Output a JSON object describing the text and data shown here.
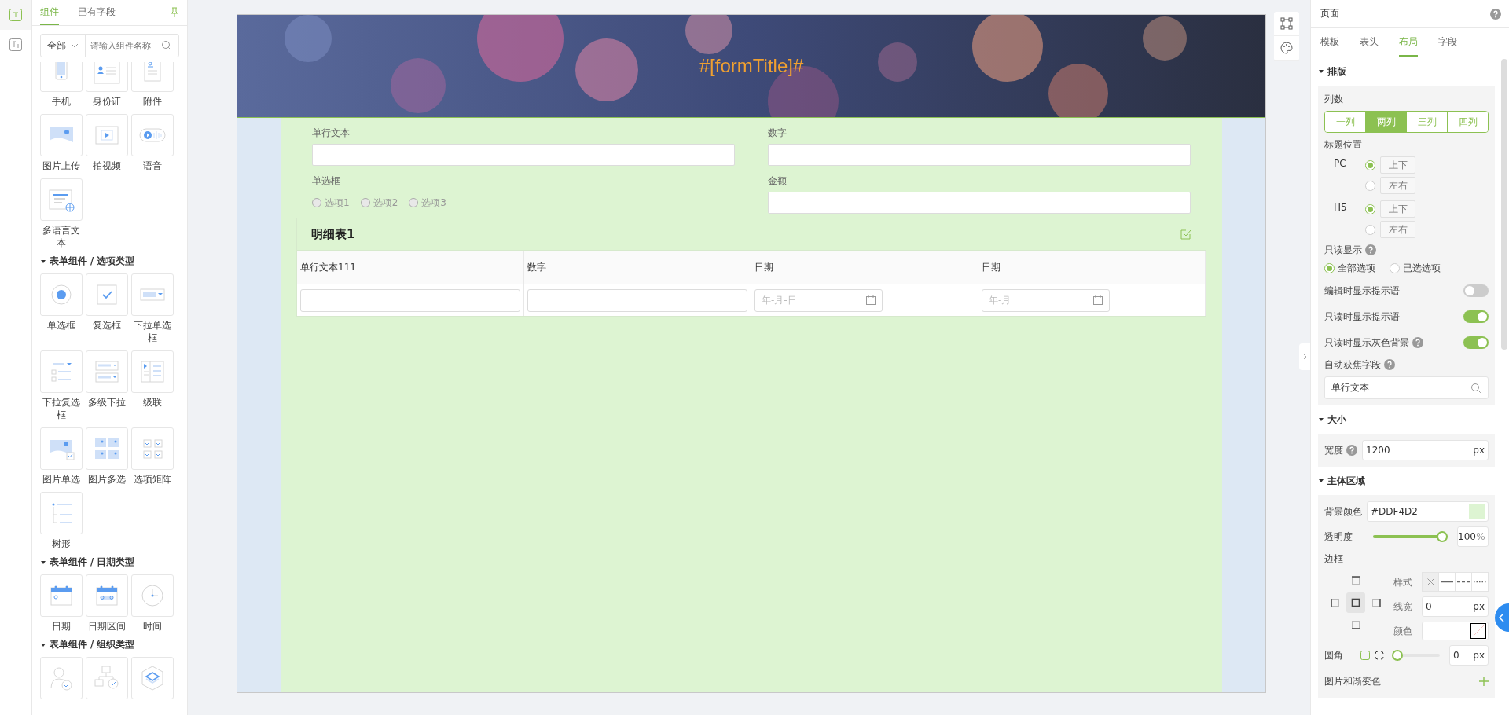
{
  "rail": {
    "items": [
      {
        "selected": true
      },
      {
        "selected": false
      }
    ]
  },
  "left_panel": {
    "tabs": [
      {
        "label": "组件",
        "selected": true
      },
      {
        "label": "已有字段",
        "selected": false
      }
    ],
    "filter": {
      "value": "全部"
    },
    "search": {
      "placeholder": "请输入组件名称"
    },
    "groups": [
      {
        "items": [
          {
            "label": "手机"
          },
          {
            "label": "身份证"
          },
          {
            "label": "附件"
          },
          {
            "label": "图片上传"
          },
          {
            "label": "拍视频"
          },
          {
            "label": "语音"
          },
          {
            "label": "多语言文本"
          }
        ]
      },
      {
        "title": "表单组件 / 选项类型",
        "items": [
          {
            "label": "单选框"
          },
          {
            "label": "复选框"
          },
          {
            "label": "下拉单选框"
          },
          {
            "label": "下拉复选框"
          },
          {
            "label": "多级下拉"
          },
          {
            "label": "级联"
          },
          {
            "label": "图片单选"
          },
          {
            "label": "图片多选"
          },
          {
            "label": "选项矩阵"
          },
          {
            "label": "树形"
          }
        ]
      },
      {
        "title": "表单组件 / 日期类型",
        "items": [
          {
            "label": "日期"
          },
          {
            "label": "日期区间"
          },
          {
            "label": "时间"
          }
        ]
      },
      {
        "title": "表单组件 / 组织类型",
        "items": [
          {
            "kind": "tile"
          },
          {
            "kind": "tile"
          },
          {
            "kind": "tile"
          }
        ]
      }
    ]
  },
  "canvas": {
    "title": "#[formTitle]#",
    "fields": [
      {
        "kind": "text",
        "label": "单行文本"
      },
      {
        "kind": "text",
        "label": "数字"
      },
      {
        "kind": "radio",
        "label": "单选框",
        "options": [
          {
            "label": "选项1",
            "selected": false
          },
          {
            "label": "选项2",
            "selected": false
          },
          {
            "label": "选项3",
            "selected": false
          }
        ]
      },
      {
        "kind": "text",
        "label": "金额"
      }
    ],
    "detail_table": {
      "title": "明细表1",
      "columns": [
        "单行文本111",
        "数字",
        "日期",
        "日期"
      ],
      "row": [
        {
          "kind": "input"
        },
        {
          "kind": "input"
        },
        {
          "kind": "date",
          "placeholder": "年-月-日"
        },
        {
          "kind": "date",
          "placeholder": "年-月"
        }
      ]
    }
  },
  "right_panel": {
    "title": "页面",
    "tabs": [
      {
        "label": "模板",
        "selected": false
      },
      {
        "label": "表头",
        "selected": false
      },
      {
        "label": "布局",
        "selected": true
      },
      {
        "label": "字段",
        "selected": false
      }
    ],
    "layout": {
      "title": "排版",
      "columns_label": "列数",
      "columns": [
        {
          "label": "一列",
          "selected": false
        },
        {
          "label": "两列",
          "selected": true
        },
        {
          "label": "三列",
          "selected": false
        },
        {
          "label": "四列",
          "selected": false
        }
      ],
      "title_position_label": "标题位置",
      "title_positions": [
        {
          "device": "PC",
          "options": [
            {
              "label": "上下",
              "selected": true
            },
            {
              "label": "左右",
              "selected": false
            }
          ]
        },
        {
          "device": "H5",
          "options": [
            {
              "label": "上下",
              "selected": true
            },
            {
              "label": "左右",
              "selected": false
            }
          ]
        }
      ],
      "readonly_label": "只读显示",
      "readonly_options": [
        {
          "label": "全部选项",
          "selected": true
        },
        {
          "label": "已选选项",
          "selected": false
        }
      ],
      "toggles": [
        {
          "label": "编辑时显示提示语",
          "on": false,
          "help": false
        },
        {
          "label": "只读时显示提示语",
          "on": true,
          "help": false
        },
        {
          "label": "只读时显示灰色背景",
          "on": true,
          "help": true
        }
      ],
      "autofocus_label": "自动获焦字段",
      "autofocus": {
        "value": "单行文本"
      }
    },
    "size": {
      "title": "大小",
      "width_label": "宽度",
      "width": {
        "value": "1200",
        "unit": "px"
      }
    },
    "body": {
      "title": "主体区域",
      "bg_label": "背景颜色",
      "bg": {
        "value": "#DDF4D2",
        "color": "#ddf4d2"
      },
      "opacity_label": "透明度",
      "opacity": {
        "level": 1,
        "value": "100",
        "unit": "%"
      },
      "border_label": "边框",
      "border_sides": [
        {
          "kind": "top",
          "selected": false
        },
        {
          "kind": "left",
          "selected": false
        },
        {
          "kind": "all",
          "selected": true
        },
        {
          "kind": "right",
          "selected": false
        },
        {
          "kind": "bottom",
          "selected": false
        }
      ],
      "style_label": "样式",
      "styles": [
        {
          "kind": "none",
          "selected": true
        },
        {
          "kind": "solid",
          "selected": false
        },
        {
          "kind": "dashed",
          "selected": false
        },
        {
          "kind": "dotted",
          "selected": false
        }
      ],
      "line_width_label": "线宽",
      "line_width": {
        "value": "0",
        "unit": "px"
      },
      "color_label": "颜色",
      "radius_label": "圆角",
      "radius": {
        "level": 0,
        "value": "0",
        "unit": "px"
      },
      "images_label": "图片和渐变色"
    }
  }
}
